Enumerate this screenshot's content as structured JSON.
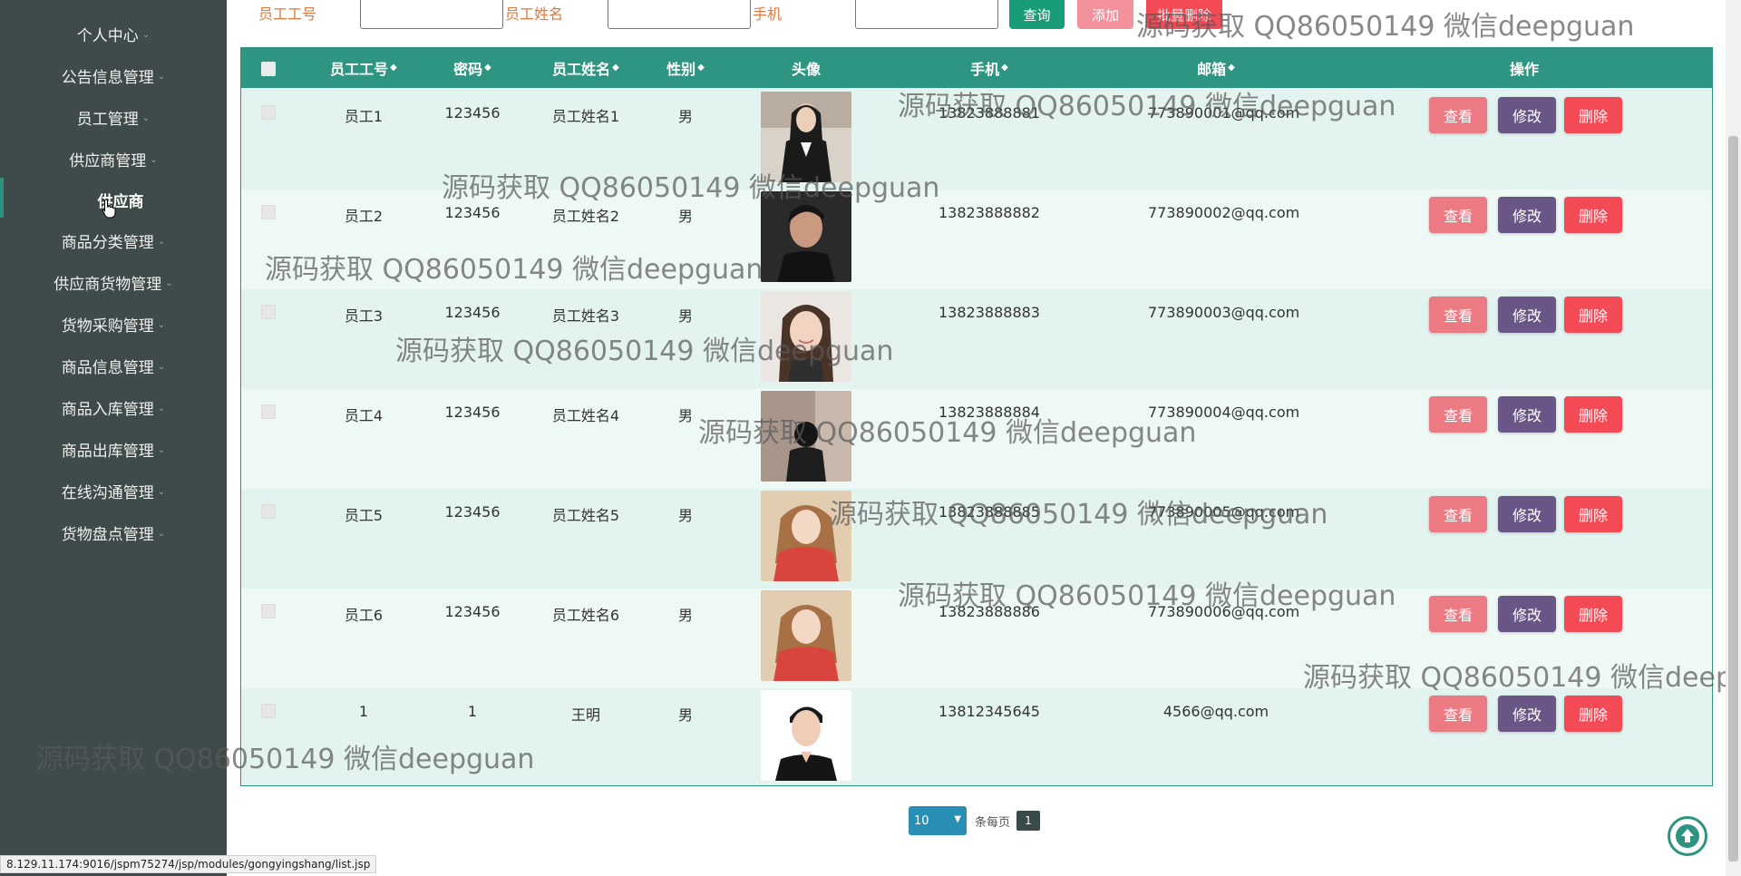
{
  "sidebar": {
    "items": [
      {
        "label": "个人中心",
        "active": false
      },
      {
        "label": "公告信息管理",
        "active": false
      },
      {
        "label": "员工管理",
        "active": false
      },
      {
        "label": "供应商管理",
        "active": false
      },
      {
        "label": "供应商",
        "active": true
      },
      {
        "label": "商品分类管理",
        "active": false
      },
      {
        "label": "供应商货物管理",
        "active": false
      },
      {
        "label": "货物采购管理",
        "active": false
      },
      {
        "label": "商品信息管理",
        "active": false
      },
      {
        "label": "商品入库管理",
        "active": false
      },
      {
        "label": "商品出库管理",
        "active": false
      },
      {
        "label": "在线沟通管理",
        "active": false
      },
      {
        "label": "货物盘点管理",
        "active": false
      }
    ]
  },
  "search": {
    "label_id": "员工工号",
    "label_name": "员工姓名",
    "label_phone": "手机",
    "value_id": "",
    "value_name": "",
    "value_phone": "",
    "query_label": "查询",
    "add_label": "添加",
    "batch_delete_label": "批量删除"
  },
  "table": {
    "headers": [
      "员工工号",
      "密码",
      "员工姓名",
      "性别",
      "头像",
      "手机",
      "邮箱",
      "操作"
    ],
    "rows": [
      {
        "id": "员工1",
        "password": "123456",
        "name": "员工姓名1",
        "gender": "男",
        "avatar": "photo-girl-dark",
        "phone": "13823888881",
        "email": "773890001@qq.com"
      },
      {
        "id": "员工2",
        "password": "123456",
        "name": "员工姓名2",
        "gender": "男",
        "avatar": "photo-boy-dark",
        "phone": "13823888882",
        "email": "773890002@qq.com"
      },
      {
        "id": "员工3",
        "password": "123456",
        "name": "员工姓名3",
        "gender": "男",
        "avatar": "photo-girl-smile",
        "phone": "13823888883",
        "email": "773890003@qq.com"
      },
      {
        "id": "员工4",
        "password": "123456",
        "name": "员工姓名4",
        "gender": "男",
        "avatar": "photo-person-back",
        "phone": "13823888884",
        "email": "773890004@qq.com"
      },
      {
        "id": "员工5",
        "password": "123456",
        "name": "员工姓名5",
        "gender": "男",
        "avatar": "photo-girl-red",
        "phone": "13823888885",
        "email": "773890005@qq.com"
      },
      {
        "id": "员工6",
        "password": "123456",
        "name": "员工姓名6",
        "gender": "男",
        "avatar": "photo-girl-red",
        "phone": "13823888886",
        "email": "773890006@qq.com"
      },
      {
        "id": "1",
        "password": "1",
        "name": "王明",
        "gender": "男",
        "avatar": "photo-man-portrait",
        "phone": "13812345645",
        "email": "4566@qq.com"
      }
    ],
    "actions": {
      "view": "查看",
      "edit": "修改",
      "delete": "删除"
    }
  },
  "pagination": {
    "page_size": "10",
    "per_page_label": "条每页",
    "current_page": "1"
  },
  "watermark_text": "源码获取 QQ86050149 微信deepguan",
  "status_url": "8.129.11.174:9016/jspm75274/jsp/modules/gongyingshang/list.jsp",
  "colors": {
    "sidebar_bg": "#3f4a4b",
    "accent": "#2f9583",
    "table_bg": "#e3f3ef",
    "view_button": "#ec7a83",
    "edit_button": "#6a5686",
    "delete_button": "#f44a56",
    "query_button": "#199d79",
    "label_orange": "#e0793f"
  }
}
